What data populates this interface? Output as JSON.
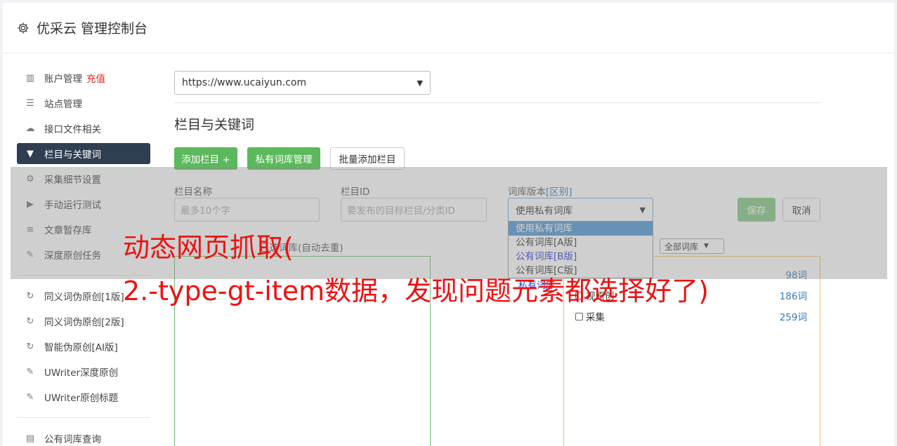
{
  "app": {
    "title": "优采云 管理控制台"
  },
  "sidebar": {
    "group1": [
      {
        "label": "账户管理",
        "badge": "充值",
        "icon": "bar-chart-icon"
      },
      {
        "label": "站点管理",
        "icon": "server-icon"
      },
      {
        "label": "接口文件相关",
        "icon": "cloud-upload-icon"
      },
      {
        "label": "栏目与关键词",
        "icon": "filter-icon",
        "active": true
      },
      {
        "label": "采集细节设置",
        "icon": "gears-icon"
      },
      {
        "label": "手动运行测试",
        "icon": "play-circle-icon"
      },
      {
        "label": "文章暂存库",
        "icon": "database-icon"
      },
      {
        "label": "深度原创任务",
        "icon": "edit-icon"
      }
    ],
    "group2": [
      {
        "label": "同义词伪原创[1版]",
        "icon": "refresh-icon"
      },
      {
        "label": "同义词伪原创[2版]",
        "icon": "refresh-icon"
      },
      {
        "label": "智能伪原创[AI版]",
        "icon": "refresh-icon"
      },
      {
        "label": "UWriter深度原创",
        "icon": "edit-icon"
      },
      {
        "label": "UWriter原创标题",
        "icon": "edit-icon"
      }
    ],
    "group3": [
      {
        "label": "公有词库查询",
        "icon": "book-icon"
      }
    ]
  },
  "site_select": {
    "value": "https://www.ucaiyun.com"
  },
  "section_title": "栏目与关键词",
  "toolbar": {
    "add_column": "添加栏目 +",
    "private_lib": "私有词库管理",
    "batch_add": "批量添加栏目"
  },
  "form": {
    "name_label": "栏目名称",
    "name_placeholder": "最多10个字",
    "id_label": "栏目ID",
    "id_placeholder": "要发布的目标栏目/分类ID",
    "lib_label": "词库版本",
    "lib_label_link": "[区别]",
    "lib_value": "使用私有词库",
    "save": "保存",
    "cancel": "取消"
  },
  "dropdown": {
    "options": [
      "使用私有词库",
      "公有词库[A版]",
      "公有词库[B版]",
      "公有词库[C版]"
    ],
    "extra": "私有词库"
  },
  "keywords_label": "已选词库(自动去重)",
  "all_libs_select": "全部词库",
  "libraries": [
    {
      "name": "",
      "count": "98词"
    },
    {
      "name": "视原创",
      "count": "186词"
    },
    {
      "name": "采集",
      "count": "259词"
    }
  ],
  "caption": {
    "line1": "动态网页抓取(",
    "line2": "2.-type-gt-item数据，发现问题元素都选择好了)"
  },
  "colors": {
    "active_nav": "#2f3e50",
    "green": "#5cb85c",
    "link": "#337ab7",
    "caption": "#ee1111"
  }
}
